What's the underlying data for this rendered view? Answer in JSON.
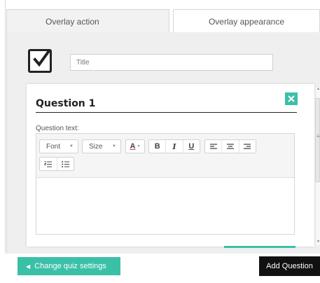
{
  "tabs": [
    {
      "label": "Overlay action",
      "active": true
    },
    {
      "label": "Overlay appearance",
      "active": false
    }
  ],
  "title_field": {
    "placeholder": "Title",
    "value": ""
  },
  "question": {
    "heading": "Question 1",
    "text_label": "Question text:",
    "body_text": ""
  },
  "toolbar": {
    "font_label": "Font",
    "size_label": "Size",
    "color_label": "A",
    "bold_label": "B",
    "italic_label": "I",
    "underline_label": "U",
    "icons": [
      "font-color-icon",
      "align-left-icon",
      "align-center-icon",
      "align-right-icon",
      "numbered-list-icon",
      "bulleted-list-icon"
    ]
  },
  "footer": {
    "change_settings_label": "Change quiz settings",
    "add_question_label": "Add Question"
  },
  "colors": {
    "accent": "#3bc0a8",
    "add_button_bg": "#111111",
    "tab_inactive_bg": "#f2f2f2",
    "panel_bg": "#efefef"
  }
}
